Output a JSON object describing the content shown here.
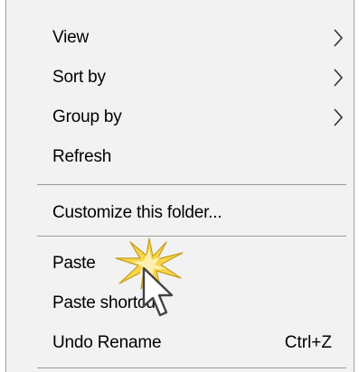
{
  "context_menu": {
    "items": [
      {
        "label": "View",
        "submenu": true
      },
      {
        "label": "Sort by",
        "submenu": true
      },
      {
        "label": "Group by",
        "submenu": true
      },
      {
        "label": "Refresh"
      },
      {
        "label": "Customize this folder..."
      },
      {
        "label": "Paste"
      },
      {
        "label": "Paste shortcut"
      },
      {
        "label": "Undo Rename",
        "shortcut": "Ctrl+Z"
      }
    ],
    "icons": {
      "submenu_arrow": "chevron-right-icon",
      "cursor": "mouse-pointer-icon",
      "click_effect": "click-burst-icon"
    },
    "colors": {
      "menu_background": "#f2f2f2",
      "separator": "#9a9a9a",
      "burst_fill": "#f6d64a",
      "burst_outline": "#c89b1a"
    }
  }
}
